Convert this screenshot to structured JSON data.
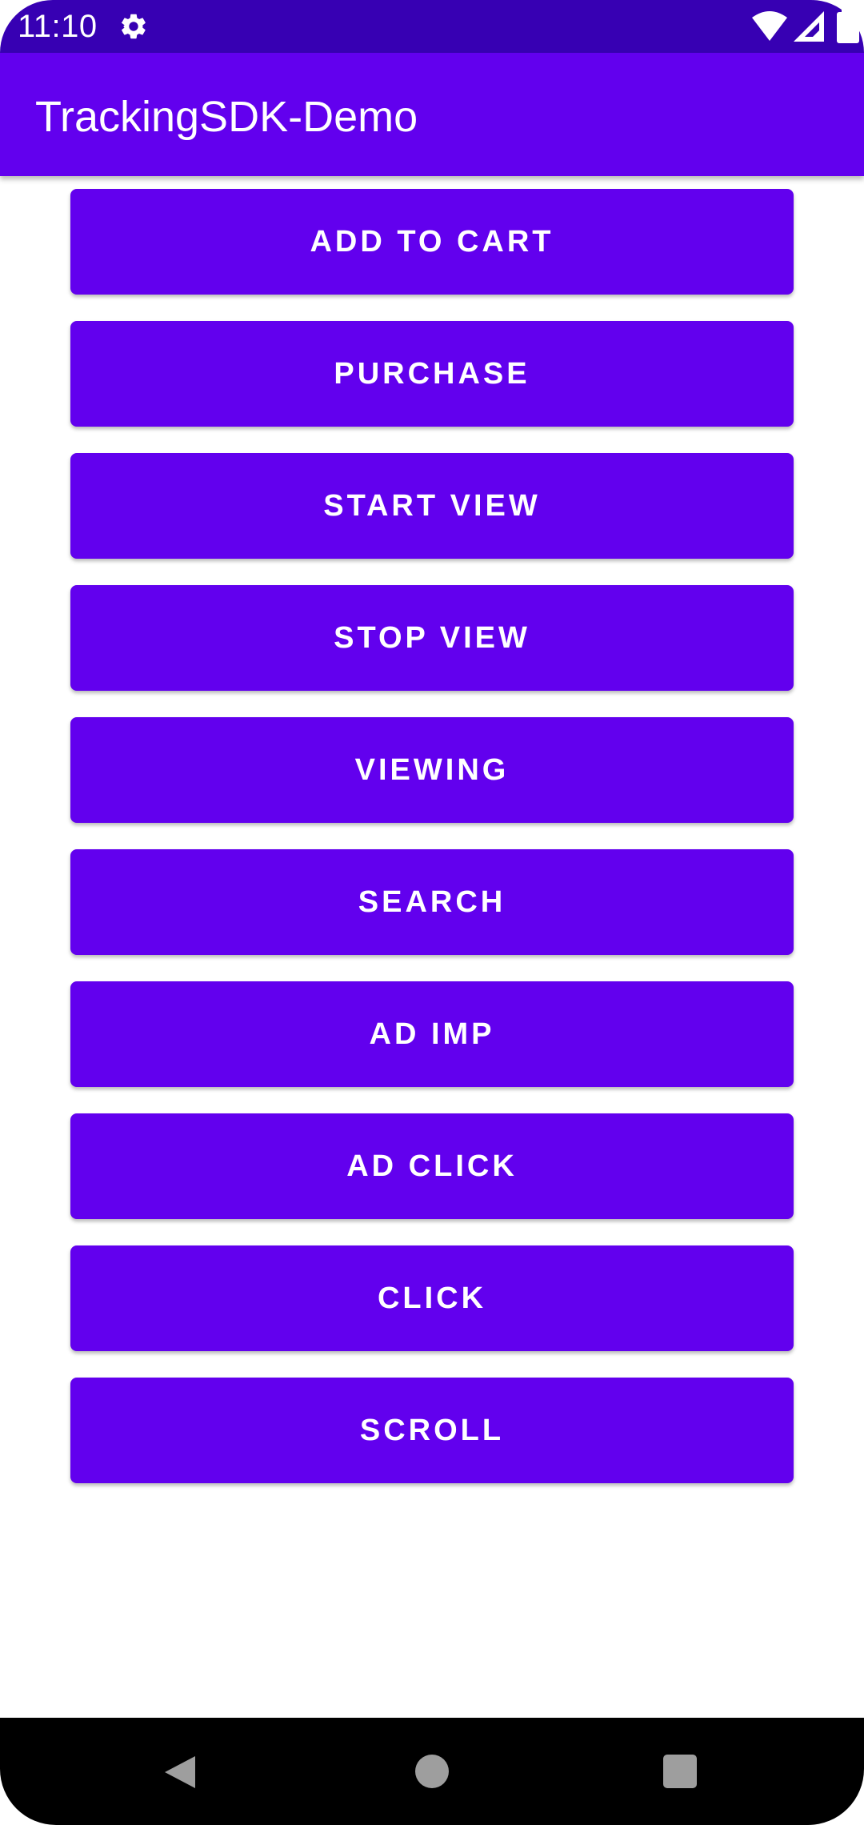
{
  "status_bar": {
    "time": "11:10",
    "icons": [
      "settings-icon",
      "wifi-icon",
      "signal-icon",
      "battery-icon"
    ]
  },
  "app_bar": {
    "title": "TrackingSDK-Demo"
  },
  "buttons": [
    "ADD TO CART",
    "PURCHASE",
    "START VIEW",
    "STOP VIEW",
    "VIEWING",
    "SEARCH",
    "AD IMP",
    "AD CLICK",
    "CLICK",
    "SCROLL"
  ],
  "nav_bar": {
    "icons": [
      "back-icon",
      "home-icon",
      "recents-icon"
    ]
  },
  "colors": {
    "status_bar": "#3700B3",
    "primary": "#6200EE",
    "nav_bar": "#000000",
    "text_on_primary": "#FFFFFF"
  }
}
